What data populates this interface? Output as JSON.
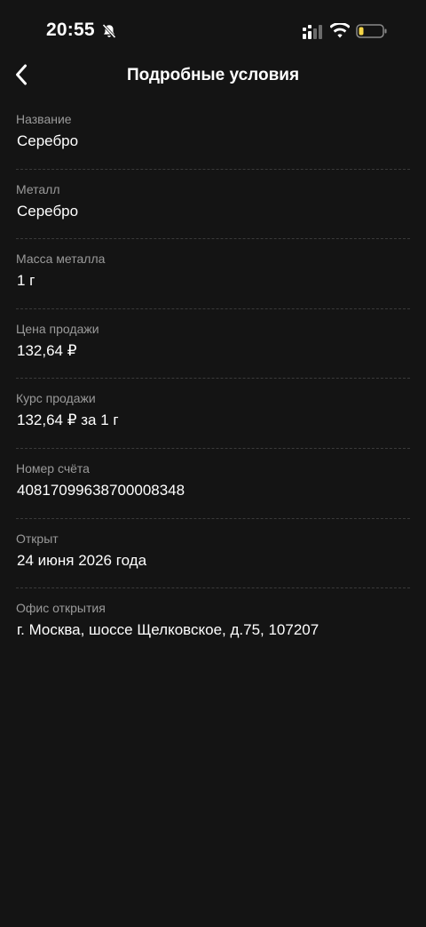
{
  "status_bar": {
    "time": "20:55",
    "icons": [
      "bell-muted-icon",
      "signal-icon",
      "wifi-icon",
      "battery-icon"
    ],
    "battery_color": "#f5d547"
  },
  "header": {
    "title": "Подробные условия",
    "back_icon": "chevron-left-icon"
  },
  "details": [
    {
      "label": "Название",
      "value": "Серебро"
    },
    {
      "label": "Металл",
      "value": "Серебро"
    },
    {
      "label": "Масса металла",
      "value": "1 г"
    },
    {
      "label": "Цена продажи",
      "value": "132,64 ₽"
    },
    {
      "label": "Курс продажи",
      "value": "132,64 ₽ за 1 г"
    },
    {
      "label": "Номер счёта",
      "value": "40817099638700008348"
    },
    {
      "label": "Открыт",
      "value": "24 июня 2026 года"
    },
    {
      "label": "Офис открытия",
      "value": "г. Москва, шоссе Щелковское, д.75, 107207"
    }
  ],
  "colors": {
    "background": "#141414",
    "label": "#9a9a9a",
    "value": "#ffffff",
    "divider": "#3a3a3a"
  }
}
